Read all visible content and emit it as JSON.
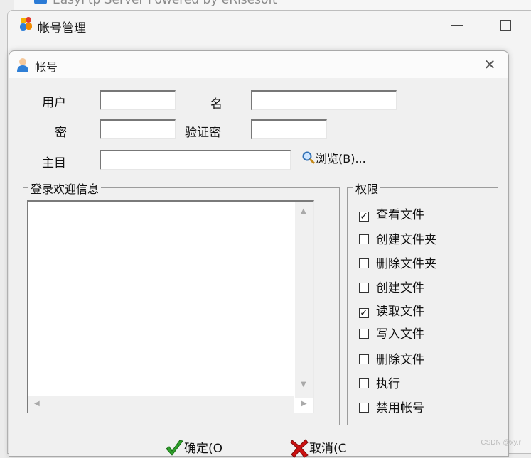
{
  "background_window": {
    "title": "EasyFtp Server Powered by eRisesoft"
  },
  "manager_window": {
    "title": "帐号管理"
  },
  "dialog": {
    "title": "帐号",
    "labels": {
      "user": "用户",
      "name": "名",
      "password": "密",
      "confirm": "验证密",
      "home_dir": "主目"
    },
    "values": {
      "user": "",
      "name": "",
      "password": "",
      "confirm": "",
      "home_dir": ""
    },
    "browse_label": "浏览(B)...",
    "welcome_group": "登录欢迎信息",
    "welcome_text": "",
    "permissions_group": "权限",
    "permissions": [
      {
        "label": "查看文件",
        "checked": true
      },
      {
        "label": "创建文件夹",
        "checked": false
      },
      {
        "label": "删除文件夹",
        "checked": false
      },
      {
        "label": "创建文件",
        "checked": false
      },
      {
        "label": "读取文件",
        "checked": true
      },
      {
        "label": "写入文件",
        "checked": false
      },
      {
        "label": "删除文件",
        "checked": false
      },
      {
        "label": "执行",
        "checked": false
      },
      {
        "label": "禁用帐号",
        "checked": false
      }
    ],
    "ok_label": "确定(O",
    "cancel_label": "取消(C"
  },
  "watermark": "CSDN @xy.r",
  "colors": {
    "ok_check": "#2fa12c",
    "cancel_x": "#cc1111",
    "user_icon": "#2f7fd6"
  }
}
